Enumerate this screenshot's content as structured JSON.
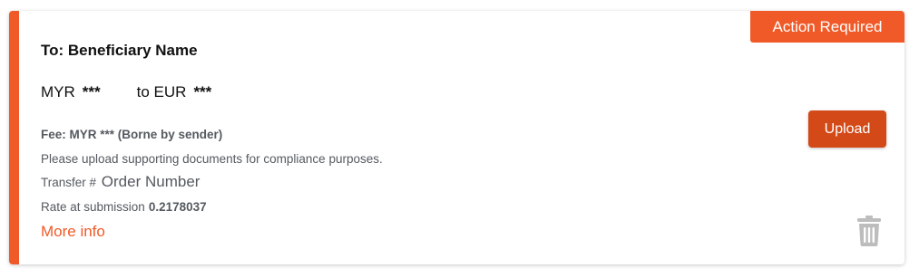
{
  "card": {
    "badge": "Action Required",
    "recipient": "To: Beneficiary Name",
    "from_currency": "MYR",
    "from_amount": "***",
    "to_label": "to EUR",
    "to_amount": "***",
    "fee": "Fee: MYR *** (Borne by sender)",
    "notice": "Please upload supporting documents for compliance purposes.",
    "transfer_label": "Transfer #",
    "transfer_value": "Order Number",
    "rate_label": "Rate at submission",
    "rate_value": "0.2178037",
    "more_info": "More info",
    "upload_label": "Upload",
    "delete_icon": "trash-icon"
  },
  "colors": {
    "accent": "#f05a28",
    "button": "#d34a18",
    "muted_text": "#555a60",
    "icon": "#bdbdbd"
  }
}
